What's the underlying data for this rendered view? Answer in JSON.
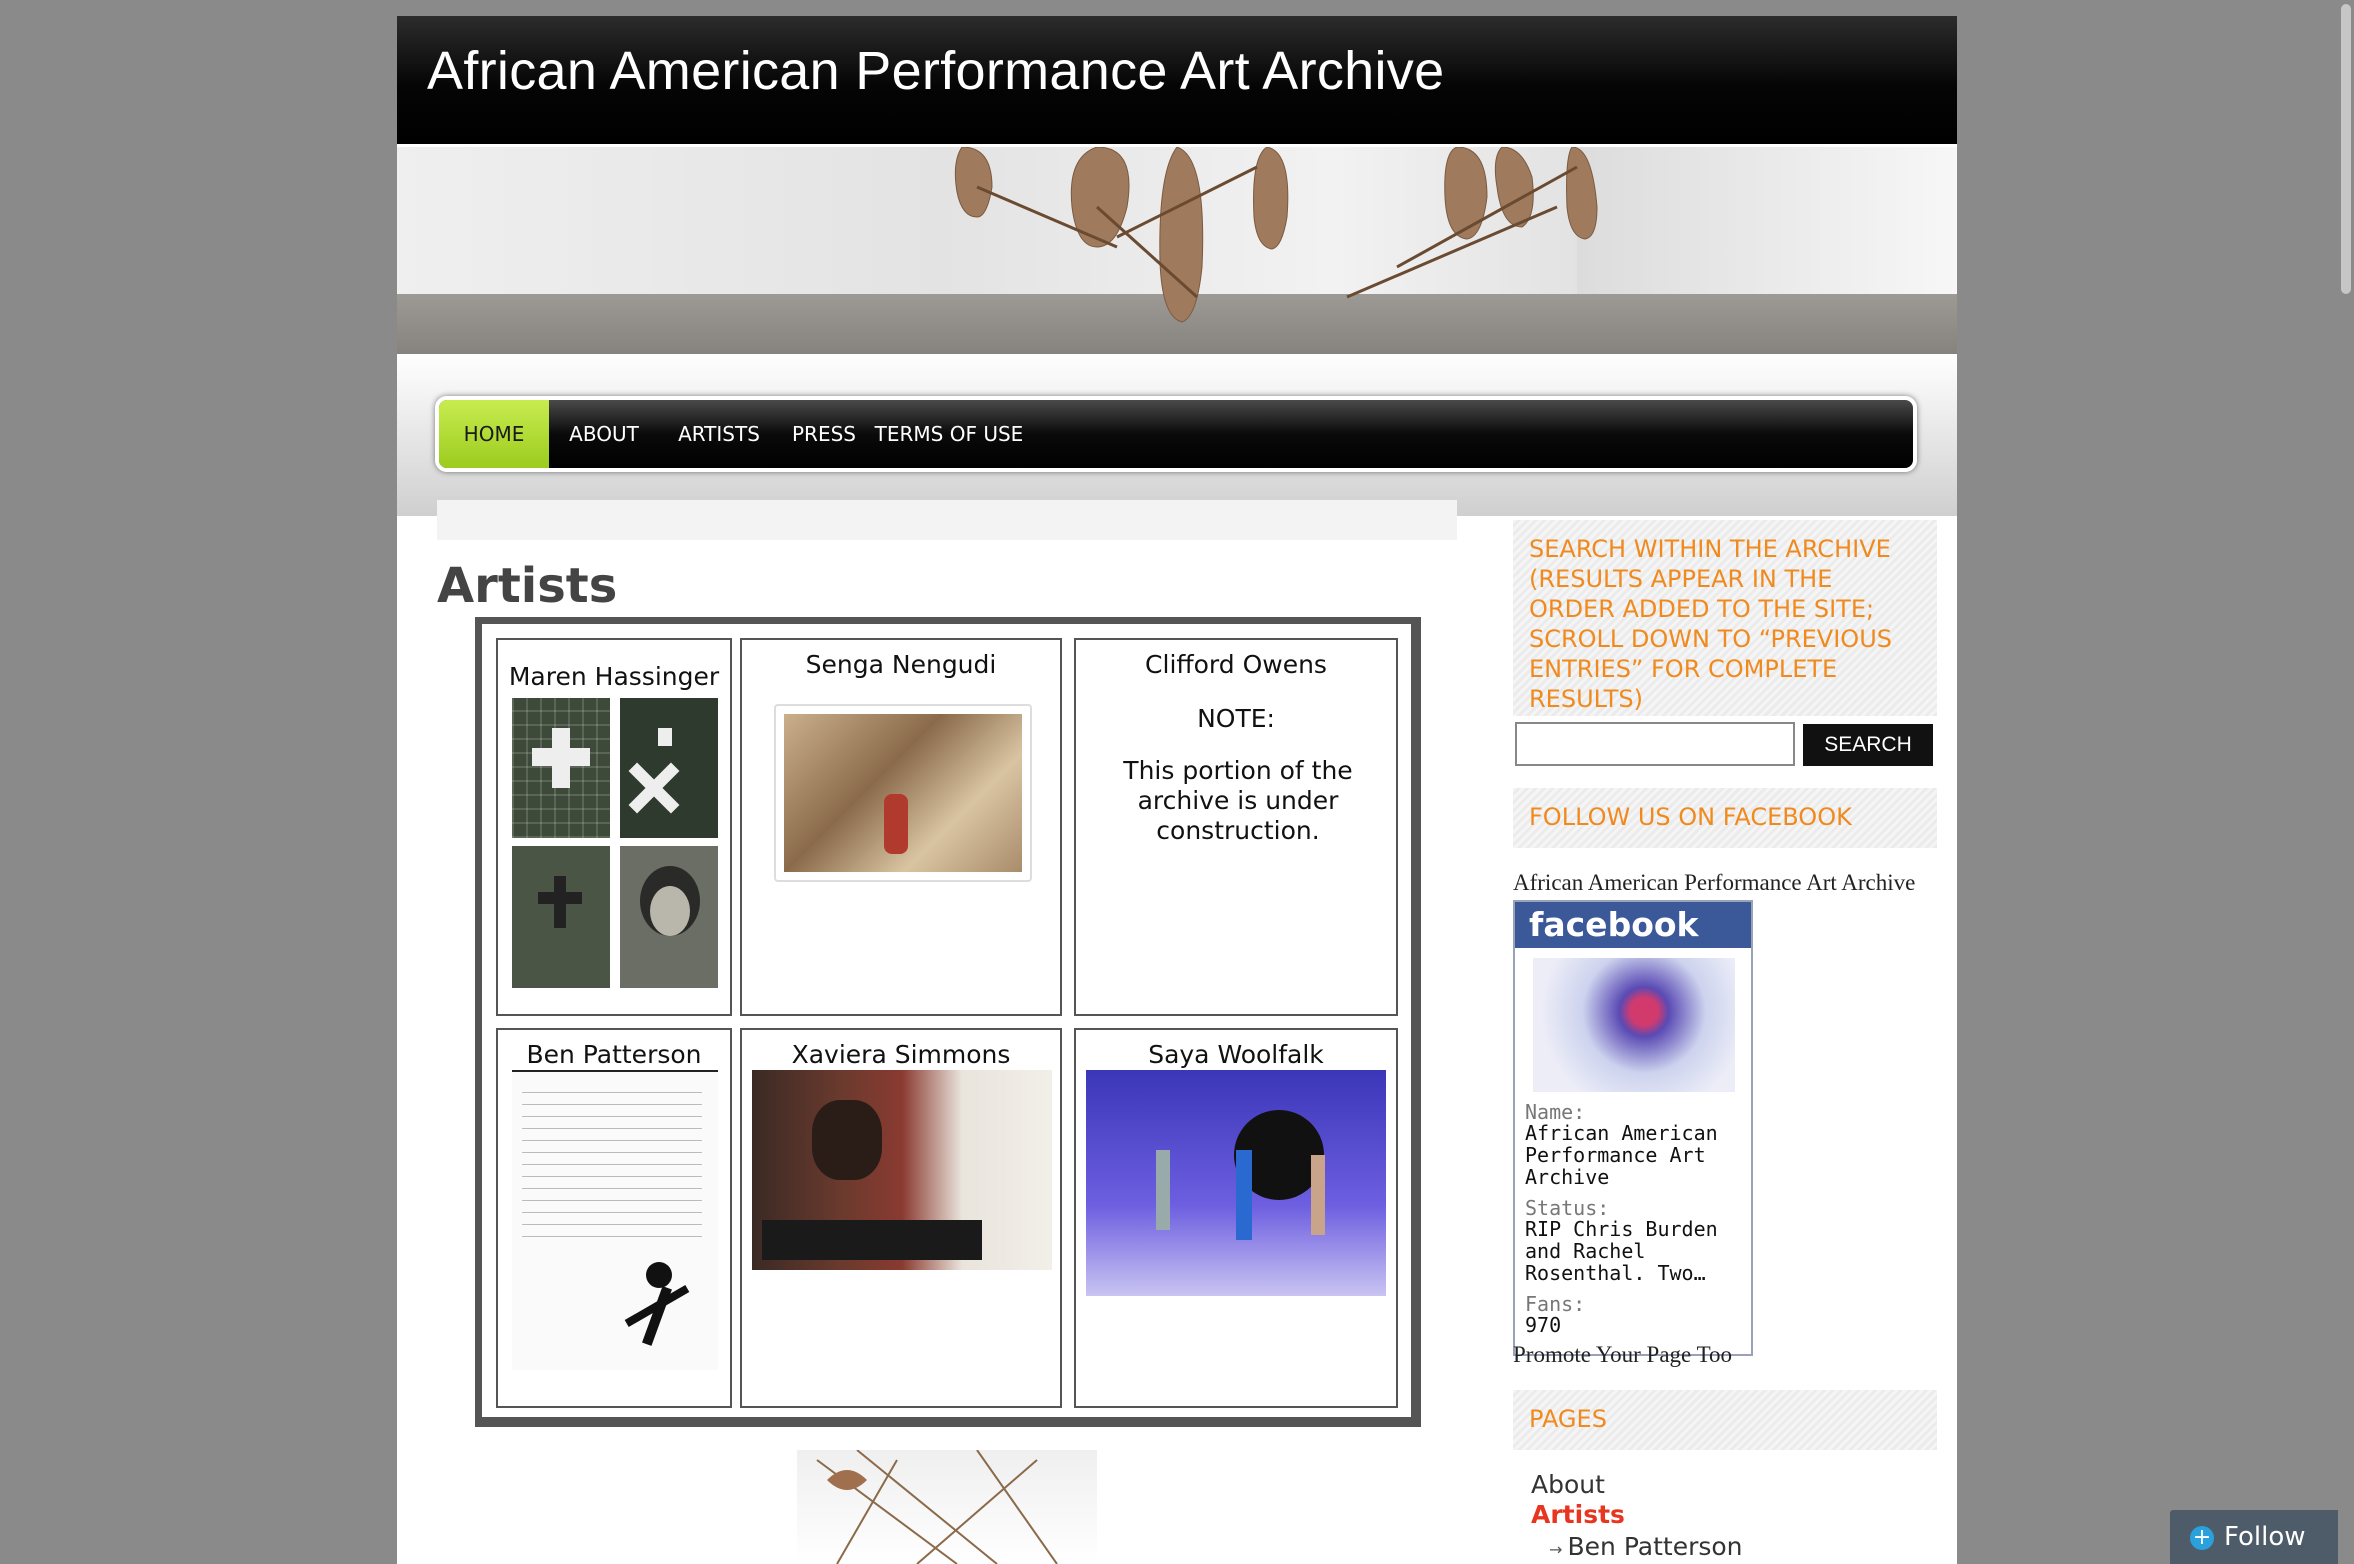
{
  "site": {
    "title": "African American Performance Art Archive"
  },
  "nav": {
    "items": [
      {
        "label": "HOME",
        "active": true
      },
      {
        "label": "ABOUT",
        "active": false
      },
      {
        "label": "ARTISTS",
        "active": false
      },
      {
        "label": "PRESS",
        "active": false
      },
      {
        "label": "TERMS OF USE",
        "active": false
      }
    ],
    "active_color": "#a6d72a"
  },
  "main": {
    "page_title": "Artists",
    "artists": [
      {
        "name": "Maren Hassinger"
      },
      {
        "name": "Senga Nengudi"
      },
      {
        "name": "Clifford Owens",
        "note_label": "NOTE:",
        "note_text": "This portion of the archive is under construction."
      },
      {
        "name": "Ben Patterson"
      },
      {
        "name": "Xaviera Simmons"
      },
      {
        "name": "Saya Woolfalk"
      }
    ]
  },
  "sidebar": {
    "search_title": "SEARCH WITHIN THE ARCHIVE (RESULTS APPEAR IN THE ORDER ADDED TO THE SITE; SCROLL DOWN TO “PREVIOUS ENTRIES” FOR COMPLETE RESULTS)",
    "search_value": "",
    "search_button": "SEARCH",
    "facebook_title": "FOLLOW US ON FACEBOOK",
    "facebook_page_link": "African American Performance Art Archive",
    "facebook_badge": {
      "brand": "facebook",
      "name_label": "Name:",
      "name_value": "African American Performance Art Archive",
      "status_label": "Status:",
      "status_value": "RIP Chris Burden and Rachel Rosenthal. Two…",
      "fans_label": "Fans:",
      "fans_value": "970"
    },
    "promote_link": "Promote Your Page Too",
    "pages_title": "PAGES",
    "pages": [
      {
        "label": "About"
      },
      {
        "label": "Artists"
      },
      {
        "label": "Ben Patterson"
      }
    ],
    "accent_color": "#f08a1f",
    "current_page_color": "#e8351f"
  },
  "follow": {
    "label": "Follow",
    "icon": "plus-circle-icon"
  }
}
